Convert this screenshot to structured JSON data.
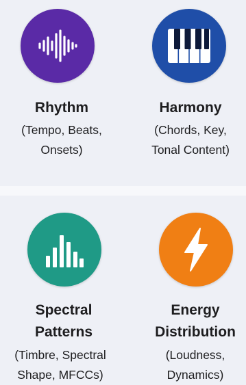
{
  "colors": {
    "rhythm": "#5a2aa6",
    "harmony": "#1f4ea8",
    "spectral": "#1f9a86",
    "energy": "#f07f14"
  },
  "cards": [
    {
      "icon": "waveform-icon",
      "title": [
        "Rhythm"
      ],
      "subtitle": [
        "(Tempo, Beats,",
        "Onsets)"
      ]
    },
    {
      "icon": "piano-keys-icon",
      "title": [
        "Harmony"
      ],
      "subtitle": [
        "(Chords, Key,",
        "Tonal Content)"
      ]
    },
    {
      "icon": "spectrum-bars-icon",
      "title": [
        "Spectral",
        "Patterns"
      ],
      "subtitle": [
        "(Timbre, Spectral",
        "Shape, MFCCs)"
      ]
    },
    {
      "icon": "lightning-bolt-icon",
      "title": [
        "Energy",
        "Distribution"
      ],
      "subtitle": [
        "(Loudness,",
        "Dynamics)"
      ]
    }
  ]
}
